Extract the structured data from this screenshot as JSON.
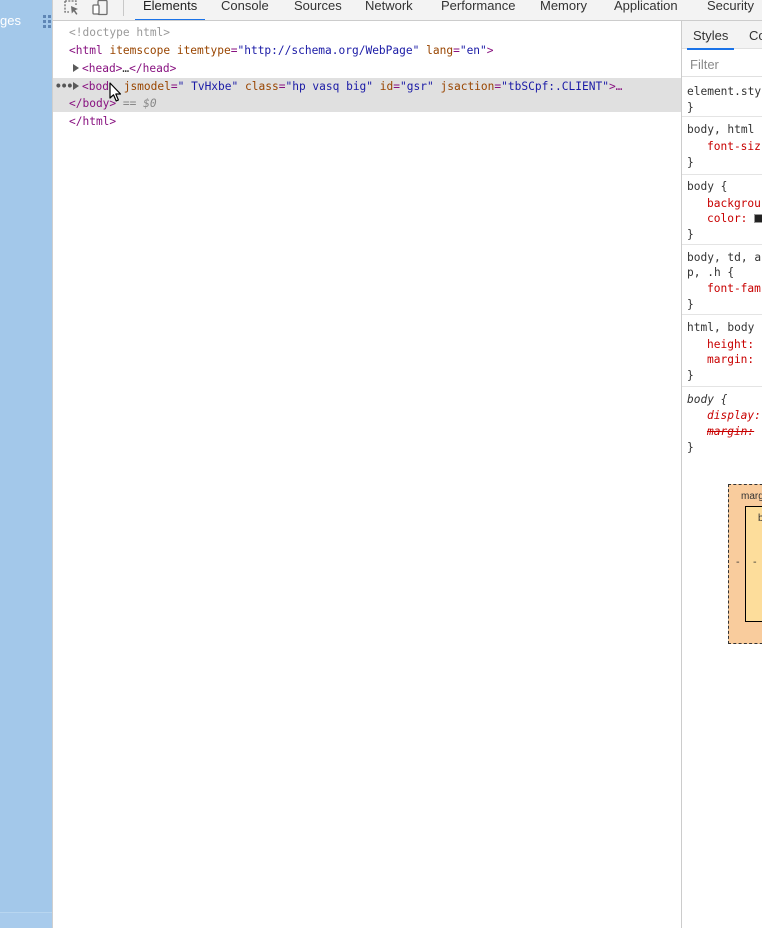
{
  "page_strip": {
    "text": "ges"
  },
  "devtools": {
    "tabs": [
      "Elements",
      "Console",
      "Sources",
      "Network",
      "Performance",
      "Memory",
      "Application",
      "Security"
    ],
    "active_tab": "Elements",
    "dom": {
      "doctype": "<!doctype html>",
      "html_open": {
        "tag": "html",
        "attrs": [
          {
            "name": "itemscope",
            "value": null
          },
          {
            "name": "itemtype",
            "value": "http://schema.org/WebPage"
          },
          {
            "name": "lang",
            "value": "en"
          }
        ]
      },
      "head_line": {
        "open": "<head>",
        "ellipsis": "…",
        "close": "</head>"
      },
      "body_line": {
        "dots": "•••",
        "tag_text": "<bod",
        "attrs": [
          {
            "name": "jsmodel",
            "value": " TvHxbe"
          },
          {
            "name": "class",
            "value": "hp vasq big"
          },
          {
            "name": "id",
            "value": "gsr"
          },
          {
            "name": "jsaction",
            "value": "tbSCpf:.CLIENT"
          }
        ],
        "trail": ">…"
      },
      "body_close": {
        "tag": "</body>",
        "marker": "== $0"
      },
      "html_close": "</html>"
    },
    "styles": {
      "subtabs": [
        "Styles",
        "Co"
      ],
      "filter_placeholder": "Filter",
      "rules": [
        {
          "selector": "element.sty",
          "props": [],
          "close": "}"
        },
        {
          "selector": "body, html",
          "props": [
            {
              "name": "font-siz",
              "value": ""
            }
          ],
          "close": "}"
        },
        {
          "selector": "body {",
          "props": [
            {
              "name": "backgrou",
              "value": ""
            },
            {
              "name": "color:",
              "value": ""
            }
          ],
          "close": "}"
        },
        {
          "selector": "body, td, a",
          "selector2": "p, .h {",
          "props": [
            {
              "name": "font-fam",
              "value": ""
            }
          ],
          "close": "}"
        },
        {
          "selector": "html, body",
          "props": [
            {
              "name": "height:",
              "value": ""
            },
            {
              "name": "margin:",
              "value": ""
            }
          ],
          "close": "}"
        },
        {
          "selector": "body {",
          "props": [
            {
              "name": "display:",
              "value": ""
            },
            {
              "name": "margin:",
              "value": ""
            }
          ],
          "close": "}"
        }
      ],
      "boxmodel": {
        "margin_label": "marg",
        "border_label": "b",
        "margin_left": "-",
        "border_left": "-"
      }
    }
  }
}
